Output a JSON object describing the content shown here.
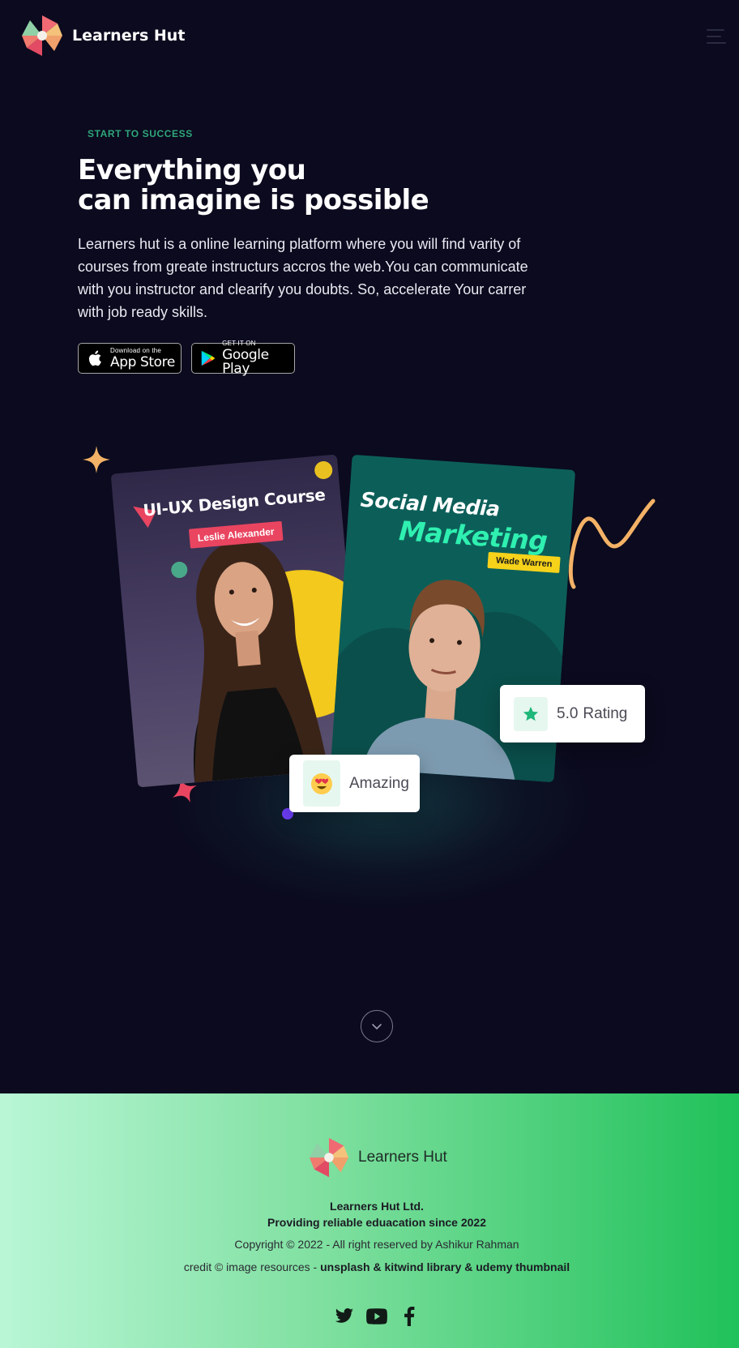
{
  "brand": {
    "name": "Learners Hut"
  },
  "hero": {
    "eyebrow": "START TO SUCCESS",
    "title_line1": "Everything you",
    "title_line2": "can imagine is possible",
    "description": "Learners hut is a online learning platform where you will find varity of courses from greate instructurs accros the web.You can communicate with you instructor and clearify you doubts. So, accelerate Your carrer with job ready skills."
  },
  "stores": {
    "apple": {
      "small": "Download on the",
      "big": "App Store"
    },
    "google": {
      "small": "GET IT ON",
      "big": "Google Play"
    }
  },
  "cards": {
    "left": {
      "title": "UI-UX Design Course",
      "instructor": "Leslie Alexander"
    },
    "right": {
      "title_line1": "Social Media",
      "title_line2": "Marketing",
      "instructor": "Wade Warren"
    }
  },
  "badges": {
    "rating_value": "5.0",
    "rating_label": "Rating",
    "amazing_label": "Amazing"
  },
  "footer": {
    "brand": "Learners Hut",
    "company": "Learners Hut Ltd.",
    "tagline": "Providing reliable eduacation since 2022",
    "copyright": "Copyright © 2022 - All right reserved by Ashikur Rahman",
    "credit_prefix": "credit © image resources - ",
    "credit_sources": "unsplash & kitwind library & udemy thumbnail",
    "socials": [
      "twitter-icon",
      "youtube-icon",
      "facebook-icon"
    ]
  },
  "colors": {
    "background": "#0b0a1e",
    "accent_green": "#2fa67a",
    "footer_gradient_start": "#b9f6d6",
    "footer_gradient_end": "#20c15a"
  }
}
